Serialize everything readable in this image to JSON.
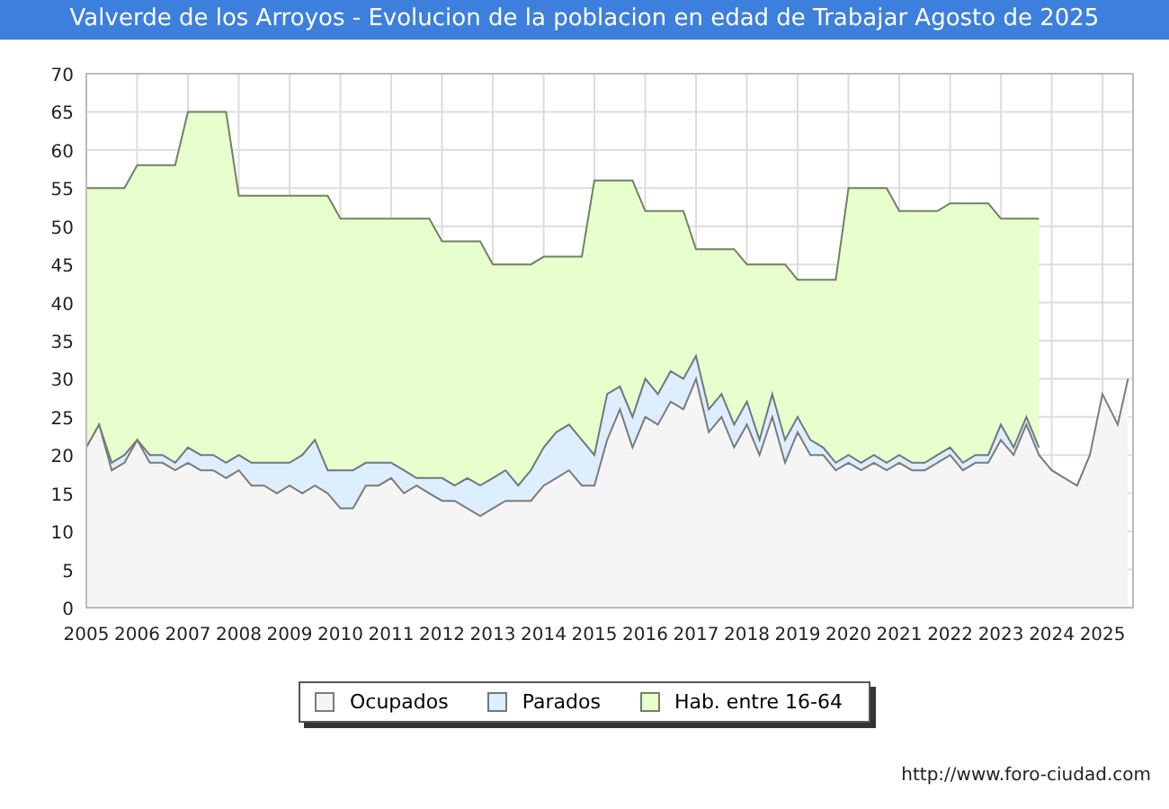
{
  "chart_data": {
    "type": "area",
    "title": "Valverde de los Arroyos - Evolucion de la poblacion en edad de Trabajar Agosto de 2025",
    "x": [
      2005,
      2005.25,
      2005.5,
      2005.75,
      2006,
      2006.25,
      2006.5,
      2006.75,
      2007,
      2007.25,
      2007.5,
      2007.75,
      2008,
      2008.25,
      2008.5,
      2008.75,
      2009,
      2009.25,
      2009.5,
      2009.75,
      2010,
      2010.25,
      2010.5,
      2010.75,
      2011,
      2011.25,
      2011.5,
      2011.75,
      2012,
      2012.25,
      2012.5,
      2012.75,
      2013,
      2013.25,
      2013.5,
      2013.75,
      2014,
      2014.25,
      2014.5,
      2014.75,
      2015,
      2015.25,
      2015.5,
      2015.75,
      2016,
      2016.25,
      2016.5,
      2016.75,
      2017,
      2017.25,
      2017.5,
      2017.75,
      2018,
      2018.25,
      2018.5,
      2018.75,
      2019,
      2019.25,
      2019.5,
      2019.75,
      2020,
      2020.25,
      2020.5,
      2020.75,
      2021,
      2021.25,
      2021.5,
      2021.75,
      2022,
      2022.25,
      2022.5,
      2022.75,
      2023,
      2023.25,
      2023.5,
      2023.75,
      2024,
      2024.25,
      2024.5,
      2024.75,
      2025,
      2025.15,
      2025.3,
      2025.5
    ],
    "series": [
      {
        "name": "Ocupados",
        "color": "#f5f5f5",
        "values": [
          21,
          24,
          18,
          19,
          22,
          19,
          19,
          18,
          19,
          18,
          18,
          17,
          18,
          16,
          16,
          15,
          16,
          15,
          16,
          15,
          13,
          13,
          16,
          16,
          17,
          15,
          16,
          15,
          14,
          14,
          13,
          12,
          13,
          14,
          14,
          14,
          16,
          17,
          18,
          16,
          16,
          22,
          26,
          21,
          25,
          24,
          27,
          26,
          30,
          23,
          25,
          21,
          24,
          20,
          25,
          19,
          23,
          20,
          20,
          18,
          19,
          18,
          19,
          18,
          19,
          18,
          18,
          19,
          20,
          18,
          19,
          19,
          22,
          20,
          24,
          20,
          18,
          17,
          16,
          20,
          28,
          26,
          24,
          30
        ]
      },
      {
        "name": "Parados",
        "color": "#ddeeff",
        "values": [
          21,
          24,
          19,
          20,
          22,
          20,
          20,
          19,
          21,
          20,
          20,
          19,
          20,
          19,
          19,
          19,
          19,
          20,
          22,
          18,
          18,
          18,
          19,
          19,
          19,
          18,
          17,
          17,
          17,
          16,
          17,
          16,
          17,
          18,
          16,
          18,
          21,
          23,
          24,
          22,
          20,
          28,
          29,
          25,
          30,
          28,
          31,
          30,
          33,
          26,
          28,
          24,
          27,
          22,
          28,
          22,
          25,
          22,
          21,
          19,
          20,
          19,
          20,
          19,
          20,
          19,
          19,
          20,
          21,
          19,
          20,
          20,
          24,
          21,
          25,
          21,
          null,
          null,
          null,
          null,
          null,
          null,
          null,
          null
        ]
      },
      {
        "name": "Hab. entre 16-64",
        "color": "#e6ffcc",
        "values": [
          55,
          55,
          55,
          55,
          58,
          58,
          58,
          58,
          65,
          65,
          65,
          65,
          54,
          54,
          54,
          54,
          54,
          54,
          54,
          54,
          51,
          51,
          51,
          51,
          51,
          51,
          51,
          51,
          48,
          48,
          48,
          48,
          45,
          45,
          45,
          45,
          46,
          46,
          46,
          46,
          56,
          56,
          56,
          56,
          52,
          52,
          52,
          52,
          47,
          47,
          47,
          47,
          45,
          45,
          45,
          45,
          43,
          43,
          43,
          43,
          55,
          55,
          55,
          55,
          52,
          52,
          52,
          52,
          53,
          53,
          53,
          53,
          51,
          51,
          51,
          51,
          null,
          null,
          null,
          null,
          null,
          null,
          null,
          null
        ]
      }
    ],
    "xlim": [
      2005,
      2025.6
    ],
    "ylim": [
      0,
      70
    ],
    "xticks": [
      2005,
      2006,
      2007,
      2008,
      2009,
      2010,
      2011,
      2012,
      2013,
      2014,
      2015,
      2016,
      2017,
      2018,
      2019,
      2020,
      2021,
      2022,
      2023,
      2024,
      2025
    ],
    "yticks": [
      0,
      5,
      10,
      15,
      20,
      25,
      30,
      35,
      40,
      45,
      50,
      55,
      60,
      65,
      70
    ],
    "stacked": false,
    "grid": true
  },
  "source_url": "http://www.foro-ciudad.com"
}
